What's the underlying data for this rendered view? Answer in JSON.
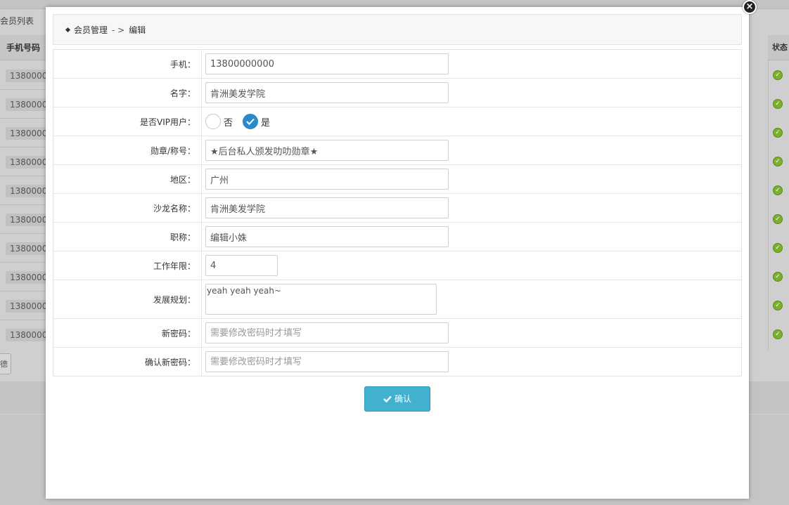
{
  "background": {
    "breadcrumb": "会员列表",
    "table_header_left": "手机号码",
    "table_header_right": "状态",
    "phone_cells": [
      "1380000",
      "1380000",
      "1380000",
      "1380000",
      "1380000",
      "1380000",
      "1380000",
      "1380000",
      "1380000",
      "1380000"
    ],
    "pager_label": "德"
  },
  "modal": {
    "close_label": "×",
    "breadcrumb": {
      "section": "会员管理",
      "separator": "- >",
      "page": "编辑"
    },
    "fields": {
      "phone": {
        "label": "手机：",
        "value": "13800000000"
      },
      "name": {
        "label": "名字：",
        "value": "肯洲美发学院"
      },
      "vip": {
        "label": "是否VIP用户：",
        "options": [
          "否",
          "是"
        ],
        "selected": "是"
      },
      "medal": {
        "label": "勋章/称号：",
        "value": "★后台私人颁发叻叻勋章★"
      },
      "region": {
        "label": "地区：",
        "value": "广州"
      },
      "salon": {
        "label": "沙龙名称：",
        "value": "肯洲美发学院"
      },
      "title": {
        "label": "职称：",
        "value": "编辑小姝"
      },
      "years": {
        "label": "工作年限：",
        "value": "4"
      },
      "plan": {
        "label": "发展规划：",
        "value": "yeah yeah yeah~"
      },
      "new_password": {
        "label": "新密码：",
        "placeholder": "需要修改密码时才填写"
      },
      "confirm_password": {
        "label": "确认新密码：",
        "placeholder": "需要修改密码时才填写"
      }
    },
    "confirm_button": "确认"
  },
  "colors": {
    "accent_blue": "#2a8ac8",
    "confirm_button": "#42b0cf",
    "status_ok_green": "#7bb02e"
  }
}
